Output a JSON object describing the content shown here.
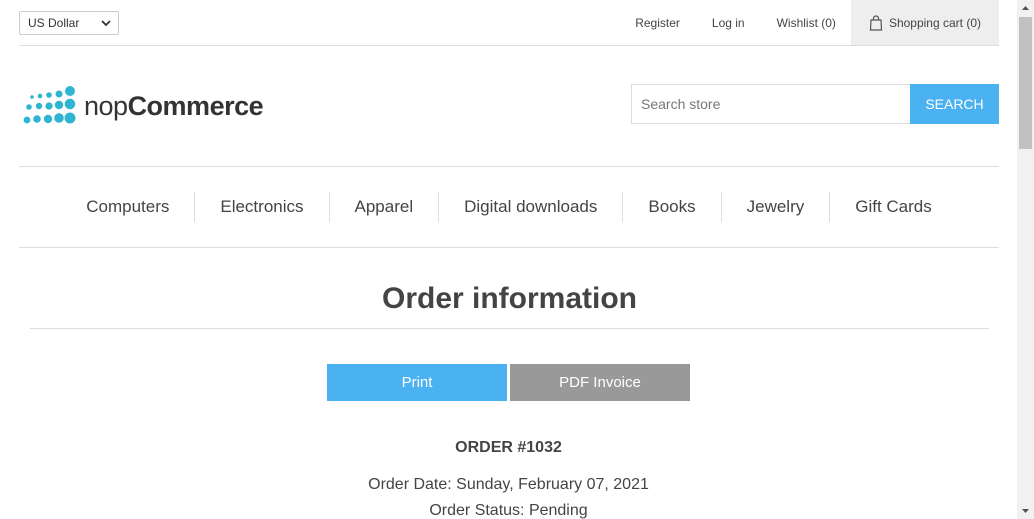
{
  "header": {
    "currency": "US Dollar",
    "links": {
      "register": "Register",
      "login": "Log in",
      "wishlist": "Wishlist (0)",
      "cart": "Shopping cart (0)"
    }
  },
  "logo": {
    "light": "nop",
    "bold": "Commerce",
    "color": "#2fb5d2"
  },
  "search": {
    "placeholder": "Search store",
    "button": "SEARCH"
  },
  "menu": [
    "Computers",
    "Electronics",
    "Apparel",
    "Digital downloads",
    "Books",
    "Jewelry",
    "Gift Cards"
  ],
  "page": {
    "title": "Order information",
    "print_label": "Print",
    "pdf_label": "PDF Invoice",
    "order_number": "ORDER #1032",
    "order_date": "Order Date: Sunday, February 07, 2021",
    "order_status": "Order Status: Pending"
  },
  "colors": {
    "accent": "#4ab2f1",
    "secondary_button": "#999999"
  }
}
